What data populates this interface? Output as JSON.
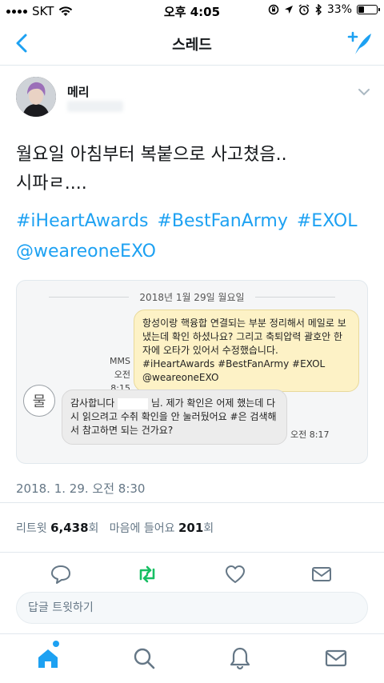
{
  "status_bar": {
    "carrier": "SKT",
    "time": "오후 4:05",
    "battery": "33%",
    "battery_level": 0.33
  },
  "nav": {
    "title": "스레드"
  },
  "tweet": {
    "author_name": "메리",
    "text_line1": "월요일 아침부터 복붙으로 사고쳤음..",
    "text_line2": "시파ㄹ....",
    "hashtags": [
      "#iHeartAwards",
      "#BestFanArmy",
      "#EXOL"
    ],
    "mention": "@weareoneEXO",
    "timestamp": "2018. 1. 29. 오전 8:30",
    "retweets_label": "리트윗",
    "retweets_count": "6,438",
    "retweets_unit": "회",
    "likes_label": "마음에 들어요",
    "likes_count": "201",
    "likes_unit": "회"
  },
  "sms": {
    "date": "2018년 1월 29일 월요일",
    "sent_text": "항성이랑 핵융합 연결되는 부분 정리해서 메일로 보냈는데 확인 하셨나요? 그리고 축퇴압력 괄호안 한자에 오타가 있어서 수정했습니다. #iHeartAwards #BestFanArmy #EXOL @weareoneEXO",
    "sent_type": "MMS",
    "sent_time": "오전 8:15",
    "contact_char": "물",
    "recv_text_a": "감사합니다",
    "recv_text_b": "님. 제가 확인은 어제 했는데 다시 읽으려고 수취 확인을 안 눌러뒀어요 #은 검색해서 참고하면 되는 건가요?",
    "recv_time": "오전 8:17"
  },
  "reply": {
    "placeholder": "답글 트윗하기"
  },
  "colors": {
    "accent": "#1da1f2",
    "retweet": "#17bf63",
    "muted": "#657786"
  }
}
